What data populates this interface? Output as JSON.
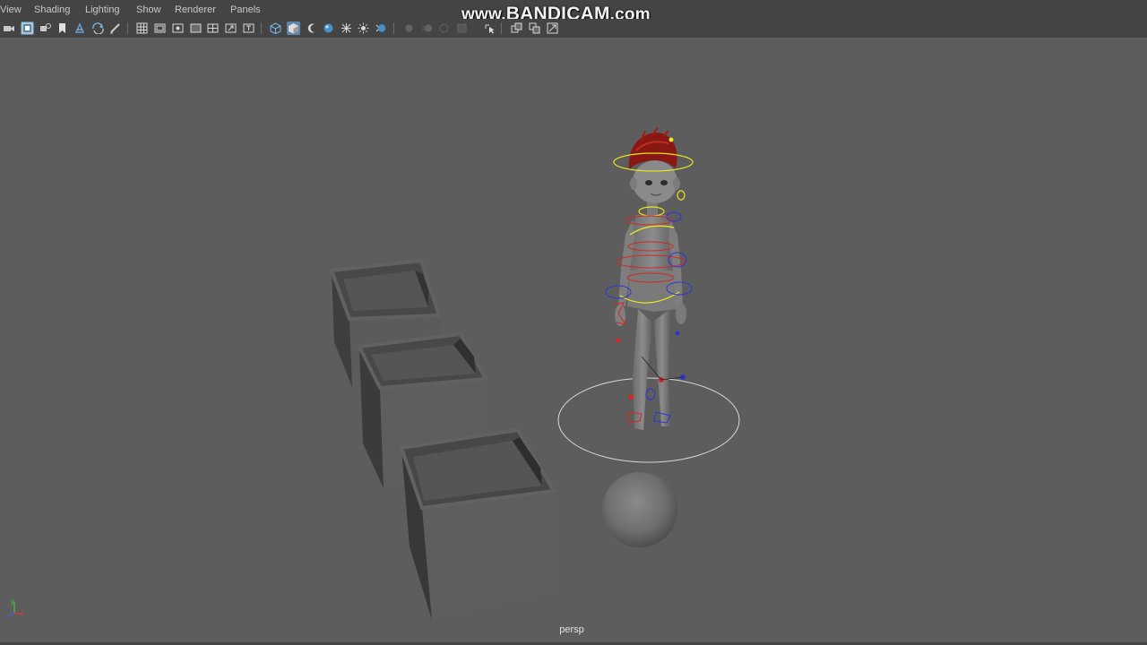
{
  "menubar": {
    "items": [
      "View",
      "Shading",
      "Lighting",
      "Show",
      "Renderer",
      "Panels"
    ]
  },
  "toolbar": {
    "buttons": [
      {
        "name": "select-camera-icon"
      },
      {
        "name": "camera-attributes-icon",
        "active": true
      },
      {
        "name": "bookmarks-icon"
      },
      {
        "name": "image-plane-icon"
      },
      {
        "name": "2d-pan-zoom-icon"
      },
      {
        "name": "grease-pencil-icon"
      },
      {
        "name": "grid-icon"
      },
      {
        "name": "film-gate-icon"
      },
      {
        "name": "resolution-gate-icon"
      },
      {
        "name": "gate-mask-icon"
      },
      {
        "name": "field-chart-icon"
      },
      {
        "name": "safe-action-icon"
      },
      {
        "name": "safe-title-icon"
      },
      {
        "name": "wireframe-icon"
      },
      {
        "name": "smooth-shade-icon",
        "active": true
      },
      {
        "name": "flat-lighting-icon"
      },
      {
        "name": "use-default-material-icon"
      },
      {
        "name": "wireframe-on-shaded-icon"
      },
      {
        "name": "textured-icon"
      },
      {
        "name": "use-all-lights-icon"
      },
      {
        "name": "shadows-icon"
      },
      {
        "name": "screen-space-ao-icon",
        "disabled": true
      },
      {
        "name": "motion-blur-icon",
        "disabled": true
      },
      {
        "name": "multisample-aa-icon",
        "disabled": true
      },
      {
        "name": "depth-of-field-icon",
        "disabled": true
      },
      {
        "name": "isolate-select-icon"
      },
      {
        "name": "xray-icon"
      },
      {
        "name": "xray-active-components-icon"
      },
      {
        "name": "xray-joints-icon"
      }
    ]
  },
  "watermark": {
    "prefix": "www.",
    "brand": "BANDICAM",
    "suffix": ".com"
  },
  "viewport": {
    "camera": "persp",
    "background_color": "#5d5d5d",
    "axis_labels": {
      "x": "x",
      "y": "y",
      "z": "z"
    }
  },
  "scene": {
    "objects": [
      "open-box-1",
      "open-box-2",
      "open-box-3",
      "character-rig",
      "sphere"
    ],
    "colors": {
      "box_light": "#5e5e5e",
      "box_mid": "#4c4c4c",
      "box_dark": "#363636",
      "hair": "#8a1812",
      "rig_yellow": "#e8e620",
      "rig_red": "#d22828",
      "rig_blue": "#2a38d0",
      "ground_circle": "#d8d8d8"
    }
  }
}
